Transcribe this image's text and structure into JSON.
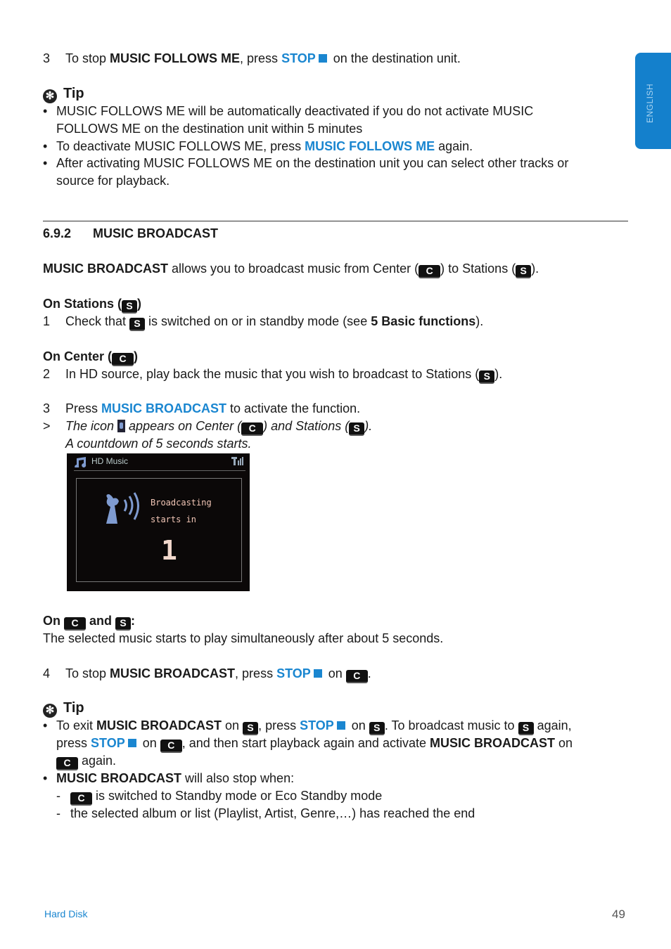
{
  "side_tab": "ENGLISH",
  "colors": {
    "accent": "#1a86d0",
    "tab": "#1480cc"
  },
  "icons": {
    "C": "C",
    "S": "S",
    "tip": "tip-asterisk-icon",
    "stop": "stop-square-icon",
    "broadcast": "broadcast-icon"
  },
  "lines": [
    {
      "m": "3",
      "segs": [
        {
          "t": "To stop "
        },
        {
          "t": "MUSIC FOLLOWS ME",
          "s": "b"
        },
        {
          "t": ", press "
        },
        {
          "t": "STOP",
          "s": "k"
        },
        {
          "icon": "sq"
        },
        {
          "t": " on the destination unit."
        }
      ]
    },
    {
      "tip": "Tip"
    },
    {
      "m": "•",
      "segs": [
        {
          "t": "MUSIC FOLLOWS ME will be automatically deactivated if you do not activate MUSIC"
        }
      ]
    },
    {
      "segs": [
        {
          "t": "FOLLOWS ME on the destination unit within 5 minutes"
        }
      ]
    },
    {
      "m": "•",
      "segs": [
        {
          "t": "To deactivate MUSIC FOLLOWS ME, press "
        },
        {
          "t": "MUSIC FOLLOWS ME",
          "s": "k"
        },
        {
          "t": " again."
        }
      ]
    },
    {
      "m": "•",
      "segs": [
        {
          "t": "After activating MUSIC FOLLOWS ME on the destination unit you can select other tracks or"
        }
      ]
    },
    {
      "segs": [
        {
          "t": "source for playback."
        }
      ]
    },
    {
      "m": "6.9.2",
      "segs": [
        {
          "t": "MUSIC BROADCAST",
          "s": "b"
        }
      ]
    },
    {
      "segs": [
        {
          "t": "MUSIC BROADCAST",
          "s": "b"
        },
        {
          "t": " allows you to broadcast music from Center ("
        },
        {
          "icon": "C"
        },
        {
          "t": ") to Stations ("
        },
        {
          "icon": "S"
        },
        {
          "t": ")."
        }
      ]
    },
    {
      "segs": [
        {
          "t": "On Stations (",
          "s": "b"
        },
        {
          "icon": "S"
        },
        {
          "t": ")",
          "s": "b"
        }
      ]
    },
    {
      "m": "1",
      "segs": [
        {
          "t": "Check that "
        },
        {
          "icon": "S"
        },
        {
          "t": " is switched on or in standby mode (see "
        },
        {
          "t": "5 Basic functions",
          "s": "b"
        },
        {
          "t": ")."
        }
      ]
    },
    {
      "segs": [
        {
          "t": "On Center (",
          "s": "b"
        },
        {
          "icon": "C"
        },
        {
          "t": ")",
          "s": "b"
        }
      ]
    },
    {
      "m": "2",
      "segs": [
        {
          "t": "In HD source, play back the music that you wish to broadcast to Stations ("
        },
        {
          "icon": "S"
        },
        {
          "t": ")."
        }
      ]
    },
    {
      "m": "3",
      "segs": [
        {
          "t": "Press "
        },
        {
          "t": "MUSIC BROADCAST",
          "s": "k"
        },
        {
          "t": " to activate the function."
        }
      ]
    },
    {
      "m": ">",
      "segs": [
        {
          "t": "The icon ",
          "s": "i"
        },
        {
          "icon": "bc"
        },
        {
          "t": " appears on Center (",
          "s": "i"
        },
        {
          "icon": "C"
        },
        {
          "t": ") and Stations (",
          "s": "i"
        },
        {
          "icon": "S"
        },
        {
          "t": ").",
          "s": "i"
        }
      ]
    },
    {
      "segs": [
        {
          "t": "A countdown of 5 seconds starts.",
          "s": "i"
        }
      ]
    },
    {
      "segs": [
        {
          "t": "On ",
          "s": "b"
        },
        {
          "icon": "C"
        },
        {
          "t": " and ",
          "s": "b"
        },
        {
          "icon": "S"
        },
        {
          "t": ":",
          "s": "b"
        }
      ]
    },
    {
      "segs": [
        {
          "t": "The selected music starts to play simultaneously after about 5 seconds."
        }
      ]
    },
    {
      "m": "4",
      "segs": [
        {
          "t": "To stop "
        },
        {
          "t": "MUSIC BROADCAST",
          "s": "b"
        },
        {
          "t": ", press "
        },
        {
          "t": "STOP",
          "s": "k"
        },
        {
          "icon": "sq"
        },
        {
          "t": " on "
        },
        {
          "icon": "C"
        },
        {
          "t": "."
        }
      ]
    },
    {
      "tip": "Tip"
    },
    {
      "m": "•",
      "segs": [
        {
          "t": "To exit "
        },
        {
          "t": "MUSIC BROADCAST",
          "s": "b"
        },
        {
          "t": " on "
        },
        {
          "icon": "S"
        },
        {
          "t": ", press "
        },
        {
          "t": "STOP",
          "s": "k"
        },
        {
          "icon": "sq"
        },
        {
          "t": " on "
        },
        {
          "icon": "S"
        },
        {
          "t": ". To broadcast music to "
        },
        {
          "icon": "S"
        },
        {
          "t": " again,"
        }
      ]
    },
    {
      "segs": [
        {
          "t": "press "
        },
        {
          "t": "STOP",
          "s": "k"
        },
        {
          "icon": "sq"
        },
        {
          "t": " on "
        },
        {
          "icon": "C"
        },
        {
          "t": ", and then start playback again and activate "
        },
        {
          "t": "MUSIC BROADCAST",
          "s": "b"
        },
        {
          "t": " on"
        }
      ]
    },
    {
      "segs": [
        {
          "icon": "C"
        },
        {
          "t": " again."
        }
      ]
    },
    {
      "m": "•",
      "segs": [
        {
          "t": "MUSIC BROADCAST",
          "s": "b"
        },
        {
          "t": " will also stop when:"
        }
      ]
    },
    {
      "m": "-",
      "segs": [
        {
          "icon": "C"
        },
        {
          "t": " is switched to Standby mode or Eco Standby mode"
        }
      ]
    },
    {
      "m": "-",
      "segs": [
        {
          "t": "the selected album or list (Playlist, Artist, Genre,…) has reached the end"
        }
      ]
    }
  ],
  "screen": {
    "title": "HD Music",
    "line1": "Broadcasting",
    "line2": "starts in",
    "countdown": "1"
  },
  "footer": {
    "section": "Hard Disk",
    "page": "49"
  }
}
